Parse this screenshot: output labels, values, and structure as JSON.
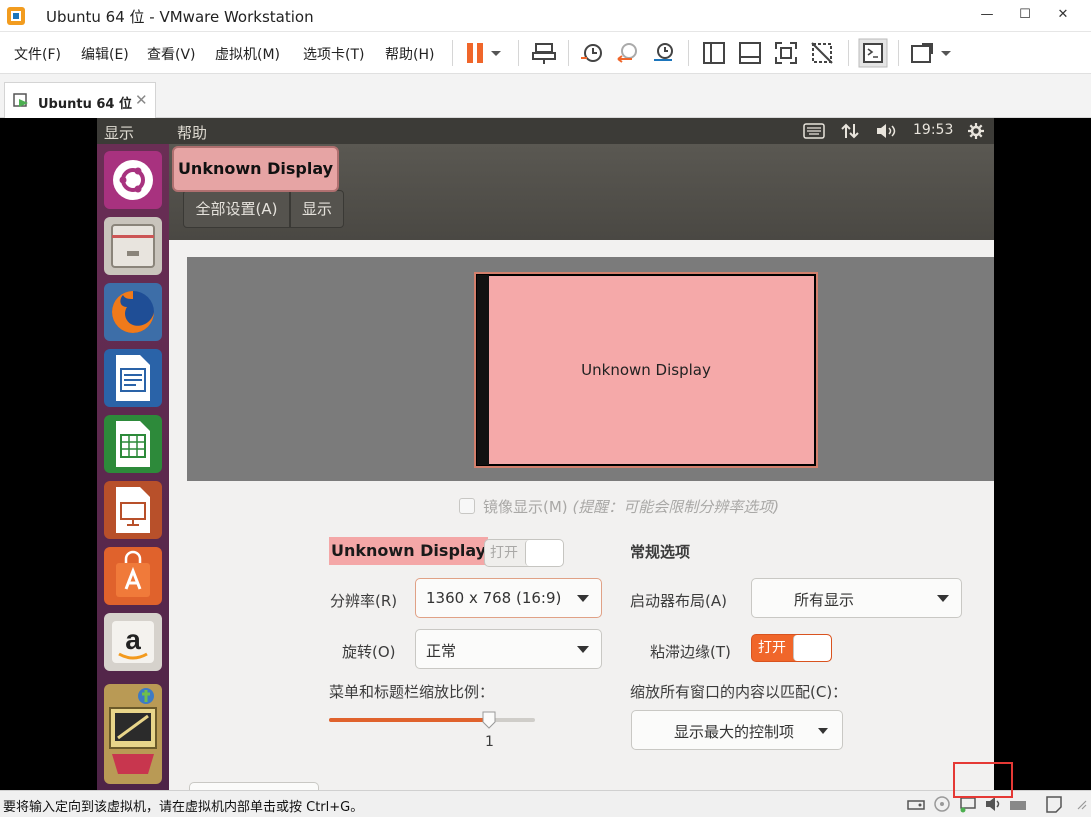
{
  "window": {
    "title": "Ubuntu 64 位 - VMware Workstation",
    "controls": {
      "minimize": "—",
      "maximize": "☐",
      "close": "✕"
    }
  },
  "menubar": {
    "items": [
      "文件(F)",
      "编辑(E)",
      "查看(V)",
      "虚拟机(M)",
      "选项卡(T)",
      "帮助(H)"
    ]
  },
  "tab": {
    "label": "Ubuntu 64 位",
    "close": "✕"
  },
  "guest_topbar": {
    "menus": [
      "显示",
      "帮助"
    ],
    "clock": "19:53"
  },
  "headerbar": {
    "window_title": "显示",
    "all_settings": "全部设置(A)",
    "current": "显示"
  },
  "overlay_label": "Unknown Display",
  "preview": {
    "monitor_label": "Unknown Display"
  },
  "mirror": {
    "label": "镜像显示(M)",
    "hint": "(提醒：可能会限制分辨率选项)"
  },
  "display": {
    "name": "Unknown Display",
    "toggle_label": "打开",
    "resolution_label": "分辨率(R)",
    "resolution_value": "1360 x 768 (16:9)",
    "rotation_label": "旋转(O)",
    "rotation_value": "正常",
    "scale_label": "菜单和标题栏缩放比例：",
    "scale_value": "1"
  },
  "general": {
    "heading": "常规选项",
    "launcher_label": "启动器布局(A)",
    "launcher_value": "所有显示",
    "sticky_label": "粘滞边缘(T)",
    "sticky_toggle": "打开",
    "scale_all_label": "缩放所有窗口的内容以匹配(C)：",
    "scale_all_value": "显示最大的控制项"
  },
  "statusbar": {
    "message": "要将输入定向到该虚拟机，请在虚拟机内部单击或按 Ctrl+G。"
  },
  "colors": {
    "launcher": "#5e2750",
    "highlight": "#f4a7a7",
    "toggle_on": "#f0662a",
    "vmware_pause": "#f0662a",
    "annotation_red": "#e53935"
  }
}
